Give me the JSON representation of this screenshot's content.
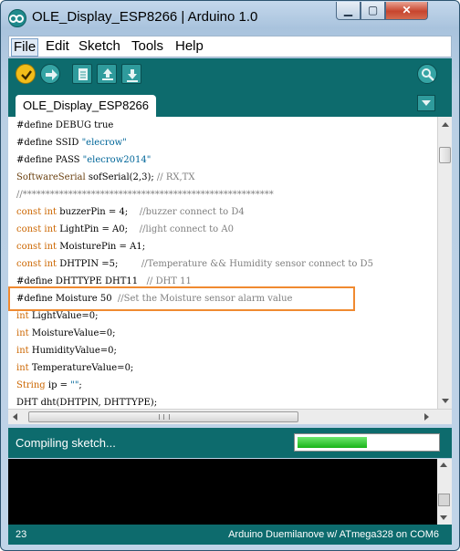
{
  "window": {
    "title": "OLE_Display_ESP8266 | Arduino 1.0",
    "min_glyph": "▁",
    "max_glyph": "▢",
    "close_glyph": "✕"
  },
  "menu": {
    "items": [
      "File",
      "Edit",
      "Sketch",
      "Tools",
      "Help"
    ]
  },
  "toolbar": {
    "buttons": [
      "verify-icon",
      "upload-icon",
      "new-icon",
      "open-icon",
      "save-icon",
      "serial-monitor-icon"
    ]
  },
  "tabs": {
    "active": "OLE_Display_ESP8266"
  },
  "editor": {
    "lines": [
      "#define DEBUG true",
      "#define SSID \"elecrow\"",
      "#define PASS \"elecrow2014\"",
      "SoftwareSerial sofSerial(2,3); // RX,TX",
      "//*******************************************************",
      "const int buzzerPin = 4;    //buzzer connect to D4",
      "const int LightPin = A0;    //light connect to A0",
      "const int MoisturePin = A1;",
      "const int DHTPIN =5;        //Temperature && Humidity sensor connect to D5",
      "#define DHTTYPE DHT11   // DHT 11",
      "#define Moisture 50  //Set the Moisture sensor alarm value",
      "int LightValue=0;",
      "int MoistureValue=0;",
      "int HumidityValue=0;",
      "int TemperatureValue=0;",
      "String ip = \"\";",
      "DHT dht(DHTPIN, DHTTYPE);"
    ],
    "highlighted_line": 10
  },
  "status": {
    "message": "Compiling sketch...",
    "progress_percent": 50
  },
  "footer": {
    "line_number": "23",
    "board": "Arduino Duemilanove w/ ATmega328 on COM6"
  },
  "colors": {
    "toolbar_bg": "#0d6b6d",
    "keyword": "#cc6600",
    "comment": "#7e7e7e",
    "string": "#006699",
    "highlight": "#f08a30",
    "progress": "#18b418"
  }
}
